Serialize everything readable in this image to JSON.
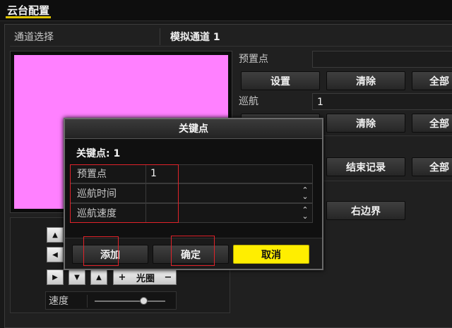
{
  "title": "云台配置",
  "channel": {
    "label": "通道选择",
    "value": "模拟通道 1"
  },
  "preset": {
    "label": "预置点",
    "value": "",
    "set_label": "设置",
    "clear_label": "清除",
    "all_label": "全部"
  },
  "patrol": {
    "label": "巡航",
    "value": "1",
    "clear_label": "清除",
    "all_label": "全部"
  },
  "pattern": {
    "stop_record_label": "结束记录",
    "all_label": "全部"
  },
  "limit": {
    "right_label": "右边界"
  },
  "ptz": {
    "iris_label": "光圈",
    "plus": "+",
    "minus": "−",
    "speed_label": "速度",
    "speed_level": 0.7
  },
  "dialog": {
    "title": "关键点",
    "keypoint_label": "关键点: 1",
    "rows": [
      {
        "label": "预置点",
        "value": "1",
        "spinner": false
      },
      {
        "label": "巡航时间",
        "value": "",
        "spinner": true
      },
      {
        "label": "巡航速度",
        "value": "",
        "spinner": true
      }
    ],
    "add_label": "添加",
    "ok_label": "确定",
    "cancel_label": "取消"
  },
  "colors": {
    "accent_yellow": "#ffee00",
    "highlight_red": "#e0232a",
    "preview_pink": "#ff80ff"
  }
}
